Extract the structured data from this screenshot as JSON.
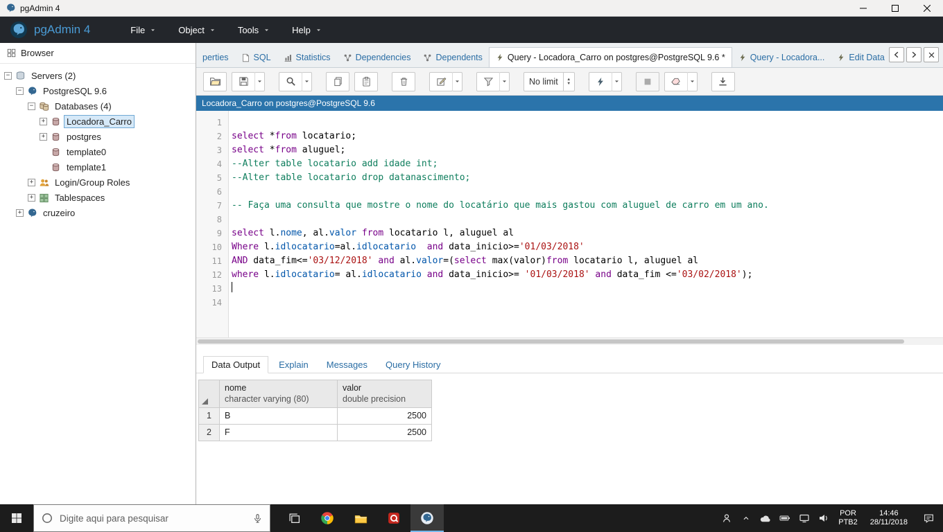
{
  "window": {
    "title": "pgAdmin 4"
  },
  "menu": {
    "brand": "pgAdmin 4",
    "items": [
      "File",
      "Object",
      "Tools",
      "Help"
    ]
  },
  "colors": {
    "accent": "#4a9bd5",
    "connection_bar": "#2b74ab",
    "selection": "#d6e9f8",
    "syntax": {
      "keyword": "#770088",
      "string": "#aa1111",
      "identifier": "#0055aa",
      "comment": "#0d7d5c"
    }
  },
  "browser": {
    "title": "Browser",
    "tree": [
      {
        "label": "Servers (2)",
        "depth": 0,
        "icon": "server-group",
        "expander": "minus"
      },
      {
        "label": "PostgreSQL 9.6",
        "depth": 1,
        "icon": "postgres-server",
        "expander": "minus"
      },
      {
        "label": "Databases (4)",
        "depth": 2,
        "icon": "database-group",
        "expander": "minus"
      },
      {
        "label": "Locadora_Carro",
        "depth": 3,
        "icon": "database",
        "expander": "plus",
        "selected": true
      },
      {
        "label": "postgres",
        "depth": 3,
        "icon": "database",
        "expander": "plus"
      },
      {
        "label": "template0",
        "depth": 3,
        "icon": "database",
        "expander": "none"
      },
      {
        "label": "template1",
        "depth": 3,
        "icon": "database",
        "expander": "none"
      },
      {
        "label": "Login/Group Roles",
        "depth": 2,
        "icon": "login-roles",
        "expander": "plus"
      },
      {
        "label": "Tablespaces",
        "depth": 2,
        "icon": "tablespaces",
        "expander": "plus"
      },
      {
        "label": "cruzeiro",
        "depth": 1,
        "icon": "postgres-server",
        "expander": "plus"
      }
    ]
  },
  "tabs": {
    "items": [
      {
        "label": "perties",
        "icon": "",
        "name": "tab-properties-partial"
      },
      {
        "label": "SQL",
        "icon": "sql-doc",
        "name": "tab-sql"
      },
      {
        "label": "Statistics",
        "icon": "statistics-chart",
        "name": "tab-statistics"
      },
      {
        "label": "Dependencies",
        "icon": "dependencies",
        "name": "tab-dependencies"
      },
      {
        "label": "Dependents",
        "icon": "dependencies",
        "name": "tab-dependents"
      },
      {
        "label": "Query - Locadora_Carro on postgres@PostgreSQL 9.6 *",
        "icon": "bolt-sm",
        "name": "tab-query-locadora-carro",
        "active": true
      },
      {
        "label": "Query - Locadora...",
        "icon": "bolt-sm",
        "name": "tab-query-locadora-2"
      },
      {
        "label": "Edit Data",
        "icon": "bolt-sm",
        "name": "tab-edit-data"
      }
    ]
  },
  "toolbar": {
    "buttons": [
      {
        "name": "open-file-button",
        "icon": "folder-open"
      },
      {
        "name": "save-button",
        "icon": "save",
        "caret": true
      },
      {
        "name": "find-button",
        "icon": "search",
        "caret": true,
        "gap": true
      },
      {
        "name": "copy-button",
        "icon": "copy",
        "gap": true
      },
      {
        "name": "paste-button",
        "icon": "paste"
      },
      {
        "name": "delete-button",
        "icon": "trash",
        "gap": true
      },
      {
        "name": "edit-button",
        "icon": "pencil",
        "caret": true,
        "gap": true
      },
      {
        "name": "filter-button",
        "icon": "funnel",
        "caret": true,
        "gap": true
      },
      {
        "type": "combo",
        "name": "row-limit-select",
        "value": "No limit",
        "gap": true
      },
      {
        "name": "execute-button",
        "icon": "bolt",
        "caret": true,
        "gap": true
      },
      {
        "name": "stop-button",
        "icon": "stop",
        "disabled": true,
        "gap": true
      },
      {
        "name": "clear-button",
        "icon": "eraser",
        "caret": true
      },
      {
        "name": "download-button",
        "icon": "download",
        "gap": true
      }
    ]
  },
  "query": {
    "connection": "Locadora_Carro on postgres@PostgreSQL 9.6"
  },
  "editor": {
    "lines": [
      {
        "n": 1,
        "tokens": []
      },
      {
        "n": 2,
        "tokens": [
          [
            "select",
            "k"
          ],
          [
            " *",
            "p"
          ],
          [
            "from",
            "k"
          ],
          [
            " locatario;",
            "p"
          ]
        ]
      },
      {
        "n": 3,
        "tokens": [
          [
            "select",
            "k"
          ],
          [
            " *",
            "p"
          ],
          [
            "from",
            "k"
          ],
          [
            " aluguel;",
            "p"
          ]
        ]
      },
      {
        "n": 4,
        "tokens": [
          [
            "--Alter table locatario add idade int;",
            "c"
          ]
        ]
      },
      {
        "n": 5,
        "tokens": [
          [
            "--Alter table locatario drop datanascimento;",
            "c"
          ]
        ]
      },
      {
        "n": 6,
        "tokens": []
      },
      {
        "n": 7,
        "tokens": [
          [
            "-- Faça uma consulta que mostre o nome do locatário que mais gastou com aluguel de carro em um ano.",
            "c"
          ]
        ]
      },
      {
        "n": 8,
        "tokens": []
      },
      {
        "n": 9,
        "tokens": [
          [
            "select",
            "k"
          ],
          [
            " l.",
            "p"
          ],
          [
            "nome",
            "v"
          ],
          [
            ", al.",
            "p"
          ],
          [
            "valor",
            "v"
          ],
          [
            " ",
            "p"
          ],
          [
            "from",
            "k"
          ],
          [
            " locatario l, aluguel al",
            "p"
          ]
        ]
      },
      {
        "n": 10,
        "tokens": [
          [
            "Where",
            "k"
          ],
          [
            " l.",
            "p"
          ],
          [
            "idlocatario",
            "v"
          ],
          [
            "=al.",
            "p"
          ],
          [
            "idlocatario",
            "v"
          ],
          [
            "  ",
            "p"
          ],
          [
            "and",
            "k"
          ],
          [
            " data_inicio>=",
            "p"
          ],
          [
            "'01/03/2018'",
            "s"
          ]
        ]
      },
      {
        "n": 11,
        "tokens": [
          [
            "AND",
            "k"
          ],
          [
            " data_fim<=",
            "p"
          ],
          [
            "'03/12/2018'",
            "s"
          ],
          [
            " ",
            "p"
          ],
          [
            "and",
            "k"
          ],
          [
            " al.",
            "p"
          ],
          [
            "valor",
            "v"
          ],
          [
            "=(",
            "p"
          ],
          [
            "select",
            "k"
          ],
          [
            " max(valor)",
            "p"
          ],
          [
            "from",
            "k"
          ],
          [
            " locatario l, aluguel al",
            "p"
          ]
        ]
      },
      {
        "n": 12,
        "tokens": [
          [
            "where",
            "k"
          ],
          [
            " l.",
            "p"
          ],
          [
            "idlocatario",
            "v"
          ],
          [
            "= al.",
            "p"
          ],
          [
            "idlocatario",
            "v"
          ],
          [
            " ",
            "p"
          ],
          [
            "and",
            "k"
          ],
          [
            " data_inicio>= ",
            "p"
          ],
          [
            "'01/03/2018'",
            "s"
          ],
          [
            " ",
            "p"
          ],
          [
            "and",
            "k"
          ],
          [
            " data_fim <=",
            "p"
          ],
          [
            "'03/02/2018'",
            "s"
          ],
          [
            ");",
            "p"
          ]
        ]
      },
      {
        "n": 13,
        "tokens": [],
        "cursor": true
      },
      {
        "n": 14,
        "tokens": []
      }
    ]
  },
  "output": {
    "tabs": [
      {
        "label": "Data Output",
        "active": true
      },
      {
        "label": "Explain"
      },
      {
        "label": "Messages"
      },
      {
        "label": "Query History"
      }
    ],
    "table": {
      "columns": [
        {
          "name": "nome",
          "type": "character varying (80)"
        },
        {
          "name": "valor",
          "type": "double precision"
        }
      ],
      "align": [
        "left",
        "right"
      ],
      "rows": [
        {
          "num": "1",
          "cells": [
            "B",
            "2500"
          ]
        },
        {
          "num": "2",
          "cells": [
            "F",
            "2500"
          ]
        }
      ]
    }
  },
  "taskbar": {
    "search_placeholder": "Digite aqui para pesquisar",
    "apps": [
      {
        "name": "task-view-button",
        "icon": "task-view"
      },
      {
        "name": "chrome-app",
        "icon": "chrome"
      },
      {
        "name": "file-explorer-app",
        "icon": "file-explorer"
      },
      {
        "name": "acrobat-app",
        "icon": "acrobat"
      },
      {
        "name": "pgadmin-app",
        "icon": "pgadmin-elephant",
        "active": true
      }
    ],
    "tray": [
      {
        "name": "people-icon",
        "icon": "people"
      },
      {
        "name": "hidden-icons-chevron",
        "icon": "chevron-up"
      },
      {
        "name": "onedrive-icon",
        "icon": "cloud"
      },
      {
        "name": "battery-icon",
        "icon": "battery"
      },
      {
        "name": "network-icon",
        "icon": "display"
      },
      {
        "name": "volume-icon",
        "icon": "volume"
      }
    ],
    "language": {
      "line1": "POR",
      "line2": "PTB2"
    },
    "clock": {
      "time": "14:46",
      "date": "28/11/2018"
    }
  }
}
